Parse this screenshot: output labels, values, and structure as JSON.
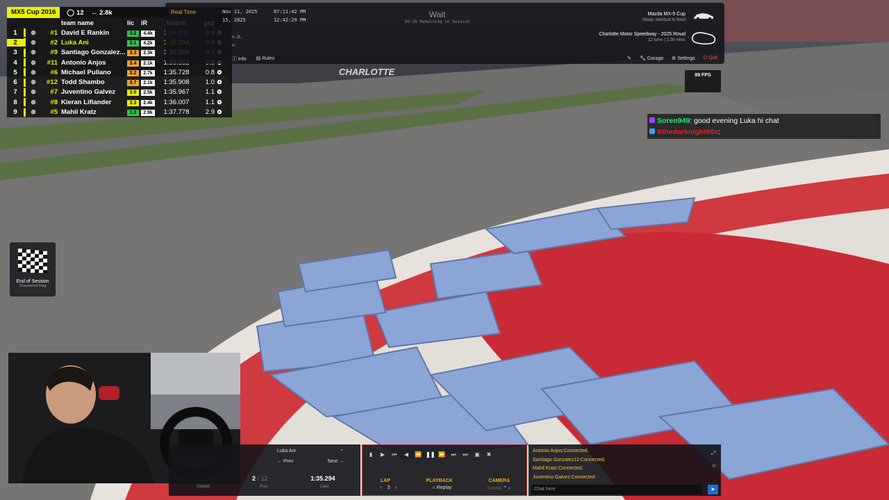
{
  "leaderboard": {
    "series": "MX5 Cup 2016",
    "field_count": "12",
    "sof": "2.8k",
    "headers": {
      "team": "team name",
      "lic": "lic",
      "ir": "iR",
      "fastest": "fastest",
      "gap": "gap"
    },
    "rows": [
      {
        "pos": "1",
        "num": "#1",
        "name": "David E Rankin",
        "lic": "3.2",
        "lic_color": "#33c24d",
        "ir": "4.4k",
        "fastest": "1:34.893",
        "gap": "0.0"
      },
      {
        "pos": "2",
        "num": "#2",
        "name": "Luka Ani",
        "lic": "3.1",
        "lic_color": "#33c24d",
        "ir": "4.2k",
        "fastest": "1:35.294",
        "gap": "0.4"
      },
      {
        "pos": "3",
        "num": "#9",
        "name": "Santiago Gonzalez...",
        "lic": "3.3",
        "lic_color": "#f0a030",
        "ir": "2.3k",
        "fastest": "1:35.558",
        "gap": "0.7"
      },
      {
        "pos": "4",
        "num": "#11",
        "name": "Antonio Anjos",
        "lic": "3.4",
        "lic_color": "#f0a030",
        "ir": "2.1k",
        "fastest": "1:35.682",
        "gap": "0.8"
      },
      {
        "pos": "5",
        "num": "#6",
        "name": "Michael Pullano",
        "lic": "3.2",
        "lic_color": "#f0a030",
        "ir": "2.7k",
        "fastest": "1:35.728",
        "gap": "0.8"
      },
      {
        "pos": "6",
        "num": "#12",
        "name": "Todd Shambo",
        "lic": "3.7",
        "lic_color": "#f0a030",
        "ir": "2.1k",
        "fastest": "1:35.908",
        "gap": "1.0"
      },
      {
        "pos": "7",
        "num": "#7",
        "name": "Juventino Galvez",
        "lic": "3.5",
        "lic_color": "#e9f200",
        "ir": "2.5k",
        "fastest": "1:35.967",
        "gap": "1.1"
      },
      {
        "pos": "8",
        "num": "#8",
        "name": "Kieran Liflander",
        "lic": "3.3",
        "lic_color": "#e9f200",
        "ir": "2.4k",
        "fastest": "1:36.007",
        "gap": "1.1"
      },
      {
        "pos": "9",
        "num": "#5",
        "name": "Mahil Kratz",
        "lic": "1.3",
        "lic_color": "#33c24d",
        "ir": "2.9k",
        "fastest": "1:37.778",
        "gap": "2.9"
      }
    ]
  },
  "topbar": {
    "realtime_label": "Real Time",
    "date1": "Nov 11, 2025",
    "date2": "15, 2025",
    "time1": "07:11:42 PM",
    "time2": "12:42:29 PM",
    "state": "Wait",
    "state_sub": "00:30 Remaining in Session",
    "car": "Mazda MX-5 Cup",
    "setup": "Setup: identical to fixed",
    "track": "Charlotte Motor Speedway - 2025 Roval",
    "track_meta": "12 turns | 2.28 miles",
    "info": "Info",
    "rules": "Rules",
    "garage": "Garage",
    "settings": "Settings",
    "quit": "Quit",
    "side_text_1": "n, 2L",
    "side_text_2": "in"
  },
  "fps": "89 FPS",
  "chat_overlay": [
    {
      "user": "Soren949",
      "text": ": good evening Luka hi chat"
    },
    {
      "user": "Xthedarknight98x",
      "text": ":"
    }
  ],
  "end_session": {
    "title": "End of Session",
    "sub": "Checkered Flag"
  },
  "replay": {
    "driver": "Luka Ani",
    "prev": "Prev",
    "next": "Next",
    "pos": "2",
    "pos_total": "/ 12",
    "last": "1:35.294",
    "speed_label": "Speed",
    "pos_label": "Pos",
    "last_label": "Last",
    "lap_label": "LAP",
    "lap_value": "3",
    "playback_label": "PLAYBACK",
    "playback_value": "Replay",
    "camera_label": "CAMERA",
    "camera_value": "Scenic"
  },
  "sim_chat": {
    "lines": [
      "Antonio Anjos:Connected.",
      "Santiago Gonzalez12:Connected.",
      "Mahil Kratz:Connected.",
      "Juventino Galvez:Connected."
    ],
    "placeholder": "Chat here"
  },
  "colors": {
    "accent_yellow": "#e9f200",
    "replay_border": "#c0262d",
    "quit": "#ff4b4b"
  }
}
